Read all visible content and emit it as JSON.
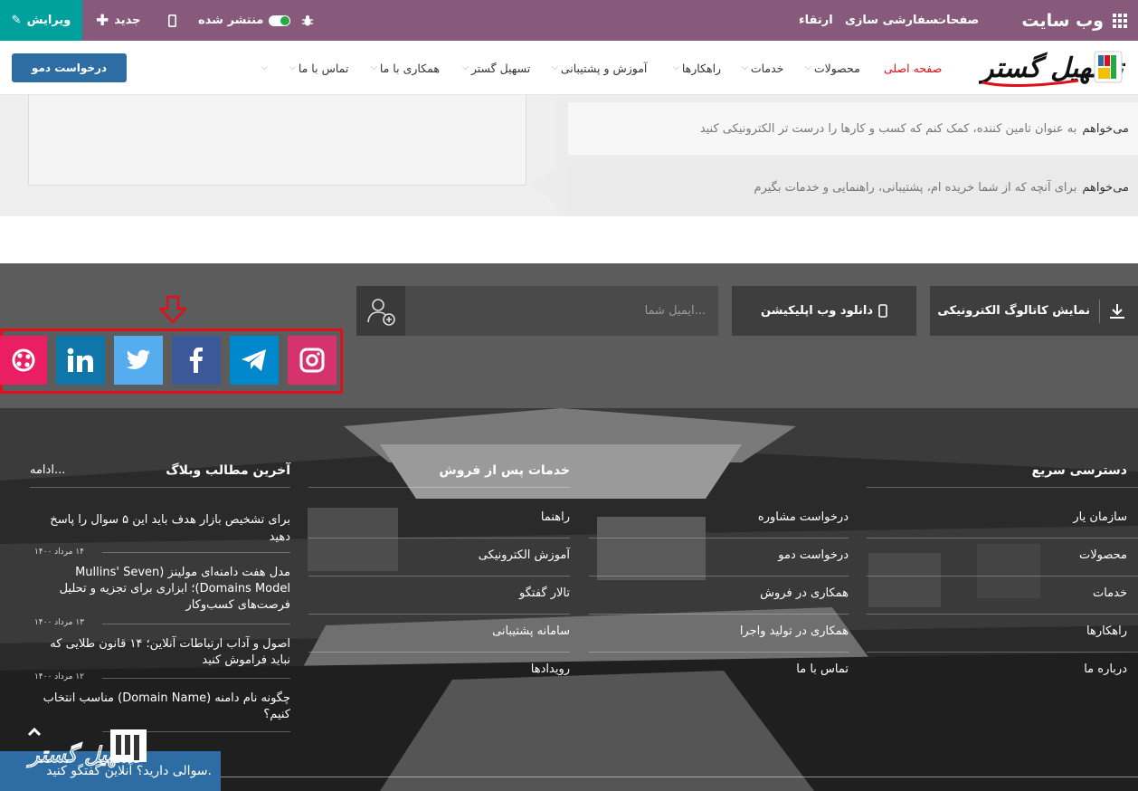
{
  "topbar": {
    "brand": "وب سایت",
    "menu": [
      "صفحات",
      "سفارشی سازی",
      "ارتقاء"
    ],
    "published_label": "منتشر شده",
    "new_label": "جدید",
    "edit_label": "ویرایش",
    "colors": {
      "bar": "#875a7b",
      "edit": "#00a09d"
    }
  },
  "header": {
    "logo_text": "تسهیل گستر",
    "nav": [
      "صفحه اصلی",
      "محصولات",
      "خدمات",
      "راهکارها",
      "آموزش و پشتیبانی",
      "تسهیل گستر",
      "همکاری با ما",
      "تماس با ما"
    ],
    "demo_button": "درخواست دمو",
    "active_color": "#e0101a"
  },
  "options": [
    {
      "lead": "می‌خواهم",
      "text": "به عنوان تامین کننده، کمک کنم که کسب و کارها را درست تر الکترونیکی کنید"
    },
    {
      "lead": "می‌خواهم",
      "text": "برای آنچه که از شما خریده ام، پشتیبانی، راهنمایی و خدمات بگیرم"
    }
  ],
  "newsletter": {
    "catalog_button": "نمایش کاتالوگ الکترونیکی",
    "app_button": "دانلود وب اپلیکیشن",
    "email_placeholder": "ایمیل شما..."
  },
  "social": [
    {
      "icon": "aparat-icon",
      "color": "#e91e63"
    },
    {
      "icon": "linkedin-icon",
      "color": "#0e76a8"
    },
    {
      "icon": "twitter-icon",
      "color": "#55acee"
    },
    {
      "icon": "facebook-icon",
      "color": "#3b5998"
    },
    {
      "icon": "telegram-icon",
      "color": "#0088cc"
    },
    {
      "icon": "instagram-icon",
      "color": "#d6336c"
    }
  ],
  "footer": {
    "quick_access": {
      "title": "دسترسی سریع",
      "col1": [
        "سازمان یار",
        "محصولات",
        "خدمات",
        "راهکارها",
        "درباره ما"
      ],
      "col2": [
        "درخواست مشاوره",
        "درخواست دمو",
        "همکاری در فروش",
        "همکاری در تولید واجرا",
        "تماس با ما"
      ]
    },
    "after_sales": {
      "title": "خدمات پس از فروش",
      "items": [
        "راهنما",
        "آموزش الکترونیکی",
        "تالار گفتگو",
        "سامانه پشتیبانی",
        "رویدادها"
      ]
    },
    "blog": {
      "title": "آخرین مطالب وبلاگ",
      "more": "ادامه...",
      "posts": [
        {
          "title": "برای تشخیص بازار هدف باید این ۵ سوال را پاسخ دهید",
          "date": "۱۴ مرداد ۱۴۰۰"
        },
        {
          "title": "مدل هفت دامنه‌ای مولینز (Mullins' Seven Domains Model)؛ ابزاری برای تجزیه و تحلیل فرصت‌های کسب‌وکار",
          "date": "۱۳ مرداد ۱۴۰۰"
        },
        {
          "title": "اصول و آداب ارتباطات آنلاین؛ ۱۴ قانون طلایی که نباید فراموش کنید",
          "date": "۱۲ مرداد ۱۴۰۰"
        },
        {
          "title": "چگونه نام دامنه (Domain Name) مناسب انتخاب کنیم؟",
          "date": ""
        }
      ]
    }
  },
  "chat": {
    "label": "سوالی دارید؟ آنلاین گفتگو کنید."
  }
}
